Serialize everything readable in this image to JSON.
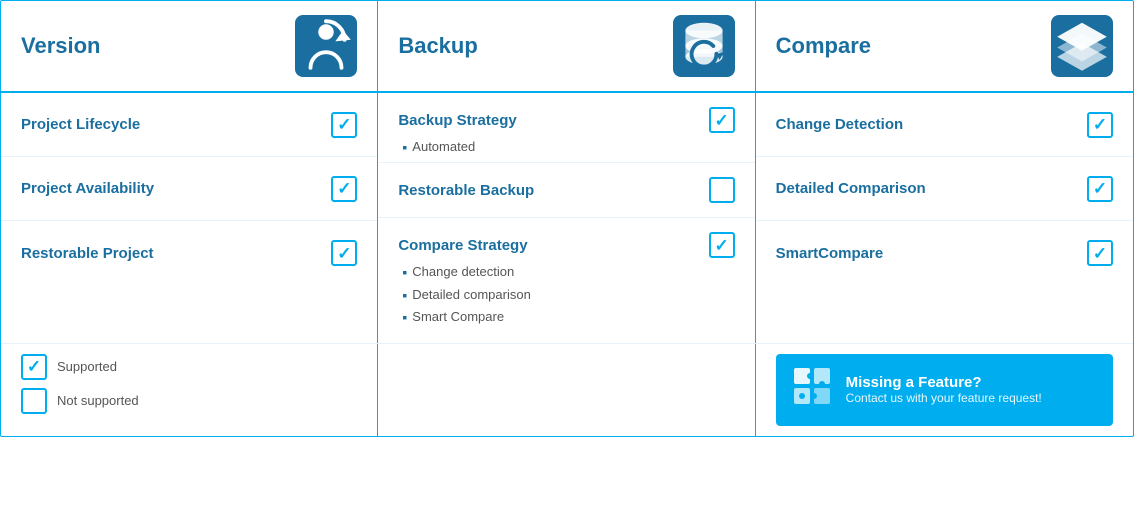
{
  "header": {
    "col1": {
      "title": "Version"
    },
    "col2": {
      "title": "Backup"
    },
    "col3": {
      "title": "Compare"
    }
  },
  "col1": {
    "features": [
      {
        "name": "Project Lifecycle",
        "checked": true
      },
      {
        "name": "Project Availability",
        "checked": true
      },
      {
        "name": "Restorable Project",
        "checked": true
      }
    ]
  },
  "col2": {
    "features": [
      {
        "name": "Backup Strategy",
        "checked": true,
        "subs": [
          "Automated"
        ]
      },
      {
        "name": "Restorable Backup",
        "checked": false,
        "subs": []
      },
      {
        "name": "Compare Strategy",
        "checked": true,
        "subs": [
          "Change detection",
          "Detailed comparison",
          "Smart Compare"
        ]
      }
    ]
  },
  "col3": {
    "features": [
      {
        "name": "Change Detection",
        "checked": true
      },
      {
        "name": "Detailed Comparison",
        "checked": true
      },
      {
        "name": "SmartCompare",
        "checked": true
      }
    ]
  },
  "legend": {
    "supported": "Supported",
    "not_supported": "Not supported"
  },
  "missing_feature": {
    "title": "Missing a Feature?",
    "subtitle": "Contact us with your feature request!"
  }
}
